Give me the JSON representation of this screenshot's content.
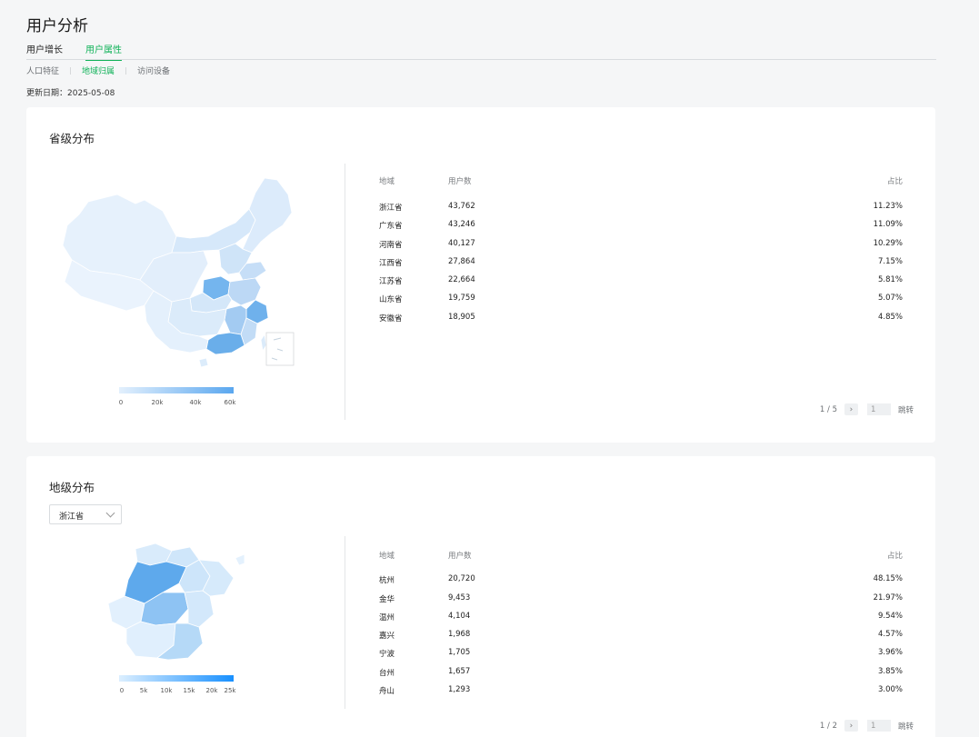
{
  "page": {
    "title": "用户分析",
    "tabs": [
      {
        "label": "用户增长",
        "active": false
      },
      {
        "label": "用户属性",
        "active": true
      }
    ],
    "subtabs": [
      {
        "label": "人口特征",
        "active": false
      },
      {
        "label": "地域归属",
        "active": true
      },
      {
        "label": "访问设备",
        "active": false
      }
    ],
    "update_label": "更新日期：",
    "update_date": "2025-05-08"
  },
  "province_card": {
    "title": "省级分布",
    "columns": {
      "region": "地域",
      "users": "用户数",
      "pct": "占比"
    },
    "rows": [
      {
        "region": "浙江省",
        "users": "43,762",
        "pct": "11.23%"
      },
      {
        "region": "广东省",
        "users": "43,246",
        "pct": "11.09%"
      },
      {
        "region": "河南省",
        "users": "40,127",
        "pct": "10.29%"
      },
      {
        "region": "江西省",
        "users": "27,864",
        "pct": "7.15%"
      },
      {
        "region": "江苏省",
        "users": "22,664",
        "pct": "5.81%"
      },
      {
        "region": "山东省",
        "users": "19,759",
        "pct": "5.07%"
      },
      {
        "region": "安徽省",
        "users": "18,905",
        "pct": "4.85%"
      }
    ],
    "pager": {
      "page_text": "1 / 5",
      "input_value": "1",
      "jump_label": "跳转"
    },
    "legend": {
      "ticks": [
        "0",
        "20k",
        "40k",
        "60k"
      ],
      "color_from": "#e3f0fd",
      "color_to": "#5aa7ef"
    }
  },
  "city_card": {
    "title": "地级分布",
    "select_value": "浙江省",
    "columns": {
      "region": "地域",
      "users": "用户数",
      "pct": "占比"
    },
    "rows": [
      {
        "region": "杭州",
        "users": "20,720",
        "pct": "48.15%"
      },
      {
        "region": "金华",
        "users": "9,453",
        "pct": "21.97%"
      },
      {
        "region": "温州",
        "users": "4,104",
        "pct": "9.54%"
      },
      {
        "region": "嘉兴",
        "users": "1,968",
        "pct": "4.57%"
      },
      {
        "region": "宁波",
        "users": "1,705",
        "pct": "3.96%"
      },
      {
        "region": "台州",
        "users": "1,657",
        "pct": "3.85%"
      },
      {
        "region": "舟山",
        "users": "1,293",
        "pct": "3.00%"
      }
    ],
    "pager": {
      "page_text": "1 / 2",
      "input_value": "1",
      "jump_label": "跳转"
    },
    "legend": {
      "ticks": [
        "0",
        "5k",
        "10k",
        "15k",
        "20k",
        "25k"
      ],
      "color_from": "#dcefff",
      "color_to": "#1890ff"
    }
  },
  "colors": {
    "accent": "#12b35a",
    "map_light": "#e6f1fc",
    "map_mid": "#b9d9f6",
    "map_dark": "#74b5ee"
  }
}
